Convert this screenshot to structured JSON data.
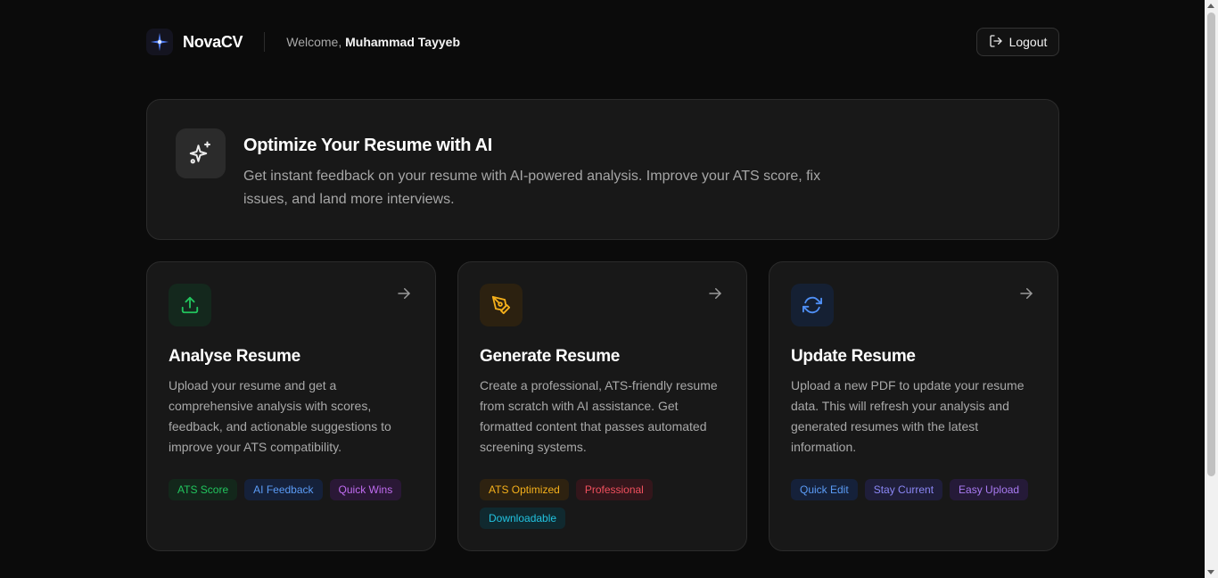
{
  "header": {
    "brand": "NovaCV",
    "welcome_prefix": "Welcome,",
    "user_name": "Muhammad Tayyeb",
    "logout_label": "Logout",
    "logo_icon": "star-sparkle-icon",
    "logout_icon": "logout-icon"
  },
  "hero": {
    "icon": "sparkles-icon",
    "title": "Optimize Your Resume with AI",
    "description": "Get instant feedback on your resume with AI-powered analysis. Improve your ATS score, fix issues, and land more interviews."
  },
  "cards": [
    {
      "icon": "upload-icon",
      "accent": "#22c55e",
      "title": "Analyse Resume",
      "description": "Upload your resume and get a comprehensive analysis with scores, feedback, and actionable suggestions to improve your ATS compatibility.",
      "tags": [
        {
          "label": "ATS Score",
          "color": "#22c55e",
          "bg": "#13271b"
        },
        {
          "label": "AI Feedback",
          "color": "#5b9cf6",
          "bg": "#15213a"
        },
        {
          "label": "Quick Wins",
          "color": "#c06cf0",
          "bg": "#2a1836"
        }
      ]
    },
    {
      "icon": "pen-tool-icon",
      "accent": "#f5b01b",
      "title": "Generate Resume",
      "description": "Create a professional, ATS-friendly resume from scratch with AI assistance. Get formatted content that passes automated screening systems.",
      "tags": [
        {
          "label": "ATS Optimized",
          "color": "#f5b01b",
          "bg": "#2e2210"
        },
        {
          "label": "Professional",
          "color": "#f0505e",
          "bg": "#33161b"
        },
        {
          "label": "Downloadable",
          "color": "#22c3e0",
          "bg": "#10292f"
        }
      ]
    },
    {
      "icon": "refresh-icon",
      "accent": "#4f8ff5",
      "title": "Update Resume",
      "description": "Upload a new PDF to update your resume data. This will refresh your analysis and generated resumes with the latest information.",
      "tags": [
        {
          "label": "Quick Edit",
          "color": "#5b9cf6",
          "bg": "#15213a"
        },
        {
          "label": "Stay Current",
          "color": "#8b87f5",
          "bg": "#1f1e3a"
        },
        {
          "label": "Easy Upload",
          "color": "#a97bf2",
          "bg": "#251a38"
        }
      ]
    }
  ]
}
